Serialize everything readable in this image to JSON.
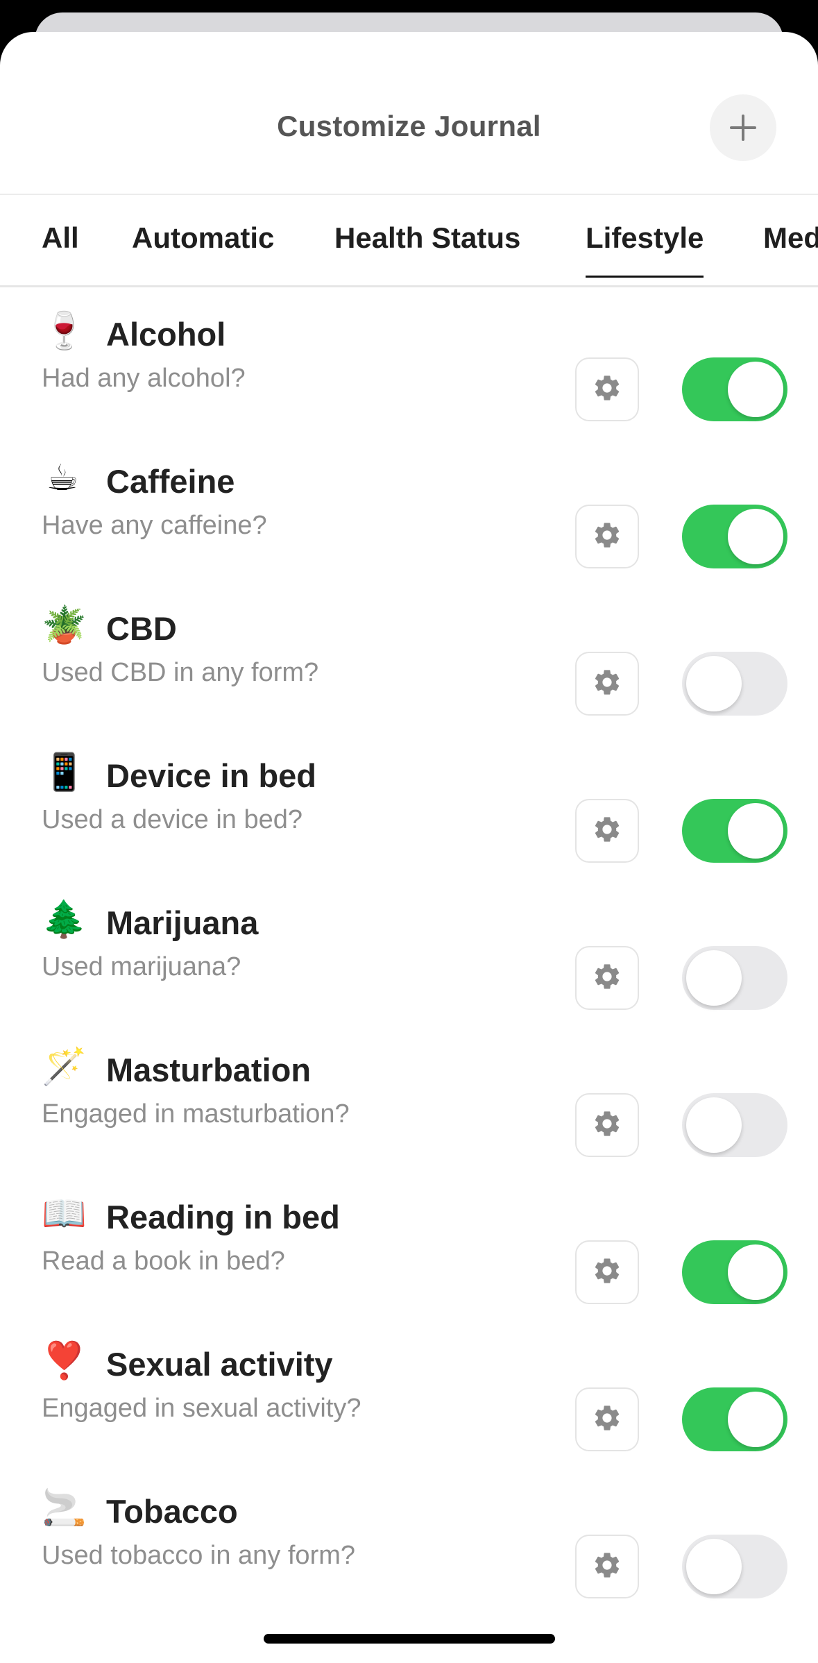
{
  "header": {
    "title": "Customize Journal",
    "add_icon": "plus-icon"
  },
  "tabs": [
    {
      "label": "All",
      "active": false
    },
    {
      "label": "Automatic",
      "active": false
    },
    {
      "label": "Health Status",
      "active": false
    },
    {
      "label": "Lifestyle",
      "active": true
    },
    {
      "label": "Med",
      "active": false
    }
  ],
  "items": [
    {
      "emoji": "🍷",
      "icon": "wine-glass-icon",
      "title": "Alcohol",
      "subtitle": "Had any alcohol?",
      "enabled": true
    },
    {
      "emoji": "☕",
      "icon": "coffee-cup-icon",
      "title": "Caffeine",
      "subtitle": "Have any caffeine?",
      "enabled": true
    },
    {
      "emoji": "🪴",
      "icon": "potted-plant-icon",
      "title": "CBD",
      "subtitle": "Used CBD in any form?",
      "enabled": false
    },
    {
      "emoji": "📱",
      "icon": "phone-icon",
      "title": "Device in bed",
      "subtitle": "Used a device in bed?",
      "enabled": true
    },
    {
      "emoji": "🌲",
      "icon": "evergreen-tree-icon",
      "title": "Marijuana",
      "subtitle": "Used marijuana?",
      "enabled": false
    },
    {
      "emoji": "🪄",
      "icon": "magic-wand-icon",
      "title": "Masturbation",
      "subtitle": "Engaged in masturbation?",
      "enabled": false
    },
    {
      "emoji": "📖",
      "icon": "open-book-icon",
      "title": "Reading in bed",
      "subtitle": "Read a book in bed?",
      "enabled": true
    },
    {
      "emoji": "❣️",
      "icon": "heart-exclamation-icon",
      "title": "Sexual activity",
      "subtitle": "Engaged in sexual activity?",
      "enabled": true
    },
    {
      "emoji": "🚬",
      "icon": "cigarette-icon",
      "title": "Tobacco",
      "subtitle": "Used tobacco in any form?",
      "enabled": false
    }
  ],
  "colors": {
    "toggle_on": "#34c759",
    "toggle_off": "#e9e9eb",
    "title_text": "#222222",
    "subtitle_text": "#8e8e8e"
  }
}
